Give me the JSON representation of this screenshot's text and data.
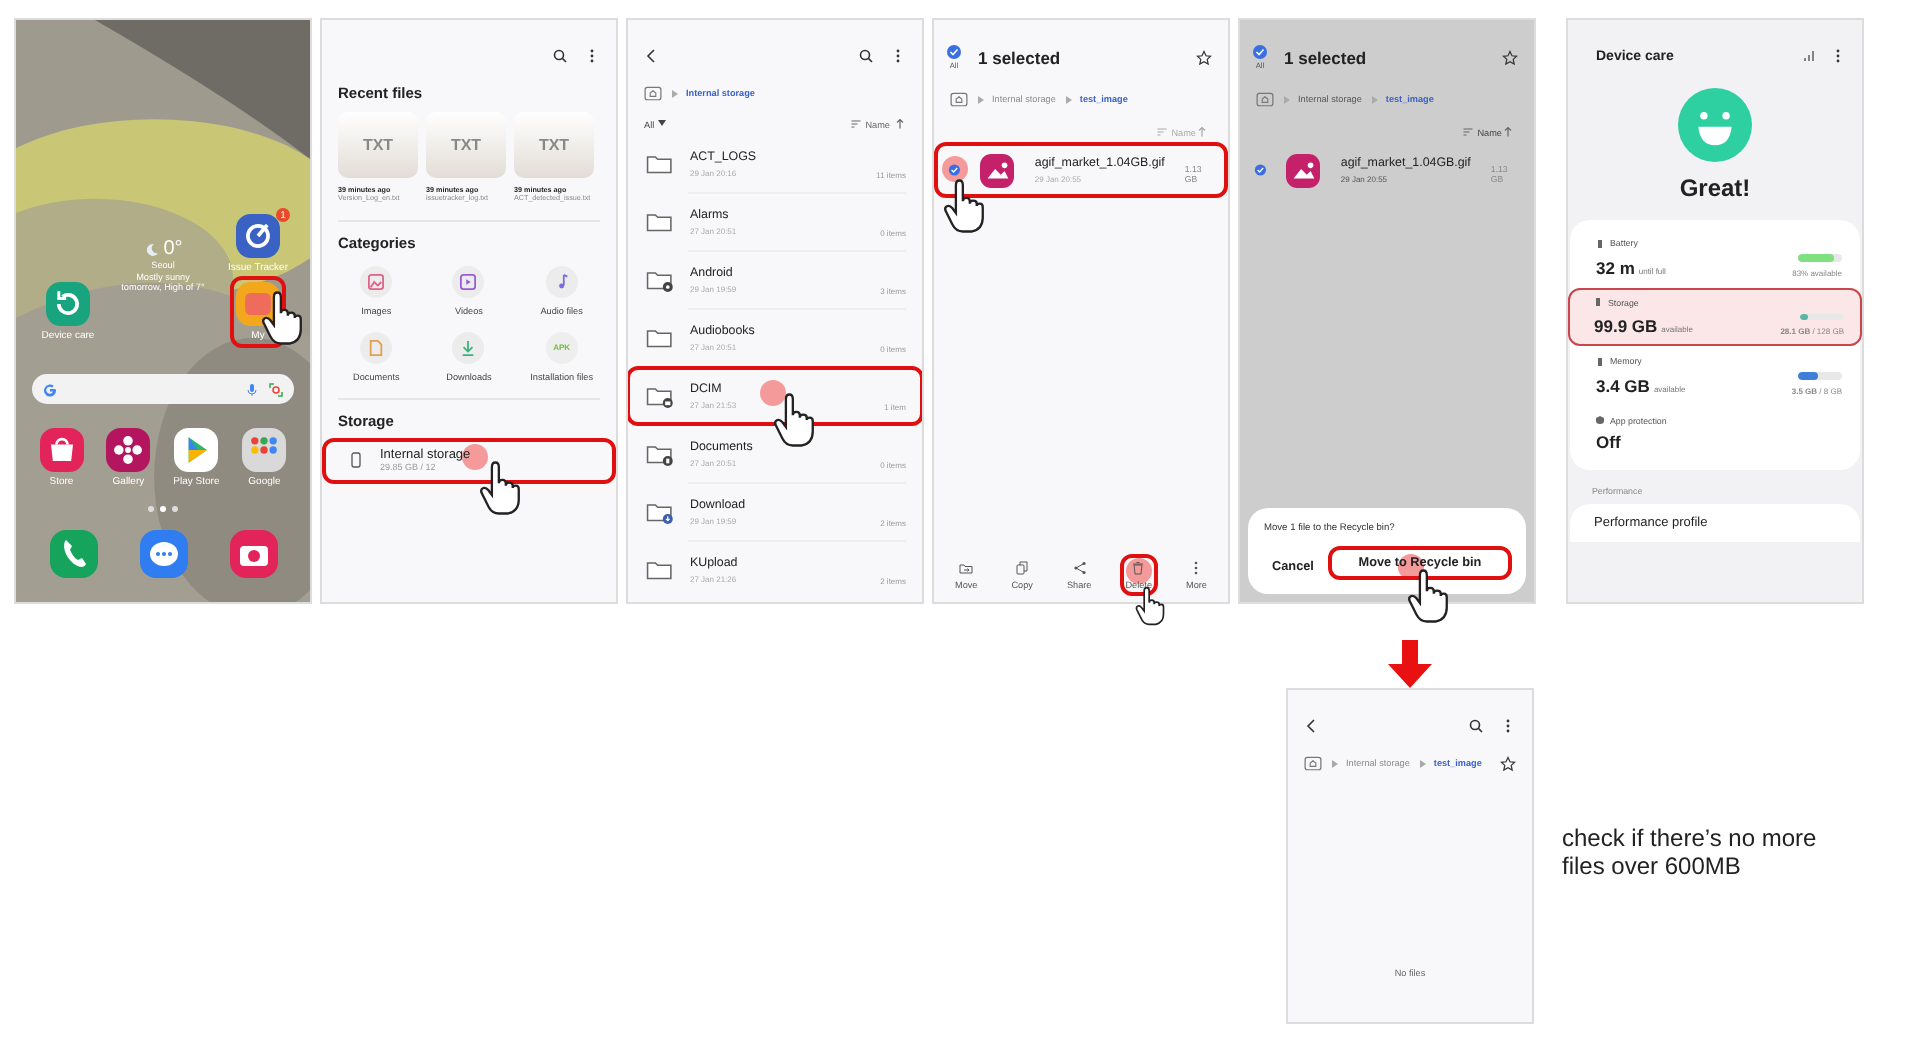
{
  "home": {
    "weather": {
      "temperature": "0°",
      "city": "Seoul",
      "condition": "Mostly sunny",
      "forecast": "tomorrow, High of 7°"
    },
    "widgets": [
      {
        "kind": "tracker",
        "label": "Issue Tracker",
        "badge": "1",
        "highlighted": false
      },
      {
        "kind": "care",
        "label": "Device care",
        "highlighted": false
      },
      {
        "kind": "files",
        "label": "My",
        "highlighted": true
      }
    ],
    "apps": [
      {
        "kind": "store",
        "label": "Store"
      },
      {
        "kind": "gallery",
        "label": "Gallery"
      },
      {
        "kind": "play",
        "label": "Play Store"
      },
      {
        "kind": "google",
        "label": "Google"
      }
    ],
    "dock": [
      {
        "kind": "phone"
      },
      {
        "kind": "messages"
      },
      {
        "kind": "camera"
      }
    ]
  },
  "my_files": {
    "recent_title": "Recent files",
    "recent": [
      {
        "thumb": "TXT",
        "time": "39 minutes ago",
        "name": "Version_Log_en.txt"
      },
      {
        "thumb": "TXT",
        "time": "39 minutes ago",
        "name": "issuetracker_log.txt"
      },
      {
        "thumb": "TXT",
        "time": "39 minutes ago",
        "name": "ACT_detected_issue.txt"
      }
    ],
    "categories_title": "Categories",
    "categories": [
      {
        "kind": "images",
        "label": "Images"
      },
      {
        "kind": "videos",
        "label": "Videos"
      },
      {
        "kind": "audio",
        "label": "Audio files"
      },
      {
        "kind": "documents",
        "label": "Documents"
      },
      {
        "kind": "downloads",
        "label": "Downloads"
      },
      {
        "kind": "apk",
        "label": "Installation files",
        "icon_text": "APK"
      }
    ],
    "storage_title": "Storage",
    "storage": [
      {
        "name": "Internal storage",
        "usage": "29.85 GB / 12",
        "highlighted": true
      }
    ]
  },
  "folder_list": {
    "breadcrumb": [
      "Internal storage"
    ],
    "filter": "All",
    "sort": "Name",
    "folders": [
      {
        "kind": "plain",
        "name": "ACT_LOGS",
        "date": "29 Jan 20:16",
        "count": "11 items",
        "highlighted": false
      },
      {
        "kind": "plain",
        "name": "Alarms",
        "date": "27 Jan 20:51",
        "count": "0 items",
        "highlighted": false
      },
      {
        "kind": "system",
        "name": "Android",
        "date": "29 Jan 19:59",
        "count": "3 items",
        "highlighted": false
      },
      {
        "kind": "plain",
        "name": "Audiobooks",
        "date": "27 Jan 20:51",
        "count": "0 items",
        "highlighted": false
      },
      {
        "kind": "camera",
        "name": "DCIM",
        "date": "27 Jan 21:53",
        "count": "1 item",
        "highlighted": true
      },
      {
        "kind": "documents",
        "name": "Documents",
        "date": "27 Jan 20:51",
        "count": "0 items",
        "highlighted": false
      },
      {
        "kind": "download",
        "name": "Download",
        "date": "29 Jan 19:59",
        "count": "2 items",
        "highlighted": false
      },
      {
        "kind": "plain",
        "name": "KUpload",
        "date": "27 Jan 21:26",
        "count": "2 items",
        "highlighted": false
      }
    ]
  },
  "selection": {
    "all_label": "All",
    "all_checked": true,
    "title": "1 selected",
    "breadcrumb": [
      "Internal storage",
      "test_image"
    ],
    "sort": "Name",
    "files": [
      {
        "name": "agif_market_1.04GB.gif",
        "date": "29 Jan 20:55",
        "size": "1.13 GB",
        "checked": true,
        "highlighted": true
      }
    ],
    "actions": [
      {
        "kind": "move",
        "label": "Move",
        "highlighted": false
      },
      {
        "kind": "copy",
        "label": "Copy",
        "highlighted": false
      },
      {
        "kind": "share",
        "label": "Share",
        "highlighted": false
      },
      {
        "kind": "delete",
        "label": "Delete",
        "highlighted": true
      },
      {
        "kind": "more",
        "label": "More",
        "highlighted": false
      }
    ]
  },
  "dialog": {
    "all_label": "All",
    "all_checked": true,
    "title": "1 selected",
    "breadcrumb": [
      "Internal storage",
      "test_image"
    ],
    "sort": "Name",
    "files": [
      {
        "name": "agif_market_1.04GB.gif",
        "date": "29 Jan 20:55",
        "size": "1.13 GB",
        "checked": true,
        "highlighted": false
      }
    ],
    "prompt": "Move 1 file to the Recycle bin?",
    "buttons": [
      {
        "label": "Cancel",
        "highlighted": false
      },
      {
        "label": "Move to Recycle bin",
        "highlighted": true
      }
    ]
  },
  "device_care": {
    "title": "Device care",
    "status": "Great!",
    "items": [
      {
        "kind": "meter",
        "label": "Battery",
        "value": "32 m",
        "unit": "until full",
        "detail": "83% available",
        "level": 0.83,
        "color": "#7fe07f",
        "highlighted": false
      },
      {
        "kind": "meter",
        "label": "Storage",
        "value": "99.9 GB",
        "unit": "available",
        "detail": "**28.1 GB** / 128 GB",
        "level": 0.2,
        "color": "#5bb5a5",
        "highlighted": true
      },
      {
        "kind": "meter",
        "label": "Memory",
        "value": "3.4 GB",
        "unit": "available",
        "detail": "**3.5 GB** / 8 GB",
        "level": 0.44,
        "color": "#3f7fd8",
        "highlighted": false
      },
      {
        "kind": "status",
        "label": "App protection",
        "value": "Off",
        "highlighted": false
      }
    ],
    "section": "Performance",
    "section_items": [
      "Performance profile"
    ]
  },
  "result": {
    "breadcrumb": [
      "Internal storage",
      "test_image"
    ],
    "empty_text": "No files"
  },
  "note": "check if there’s no more files over 600MB"
}
